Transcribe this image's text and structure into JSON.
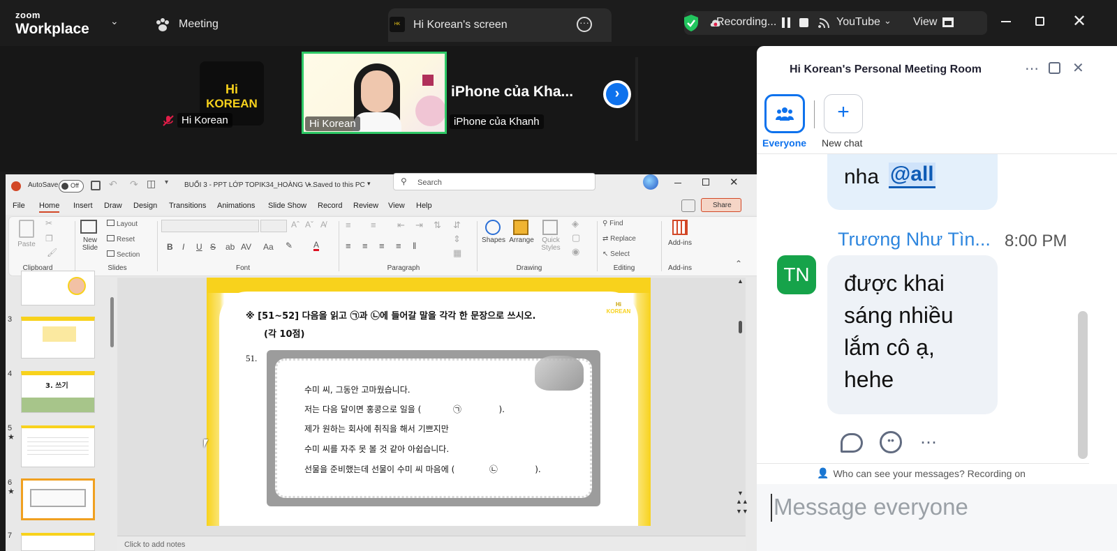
{
  "topbar": {
    "logo_small": "zoom",
    "logo_big": "Workplace",
    "meeting_label": "Meeting",
    "share_tab_label": "Hi Korean's screen",
    "recording_label": "Recording...",
    "youtube_label": "YouTube",
    "view_label": "View"
  },
  "videos": [
    {
      "name": "Hi Korean",
      "avatar_text_1": "Hi",
      "avatar_text_2": "KOREAN"
    },
    {
      "name": "Hi Korean"
    },
    {
      "name": "iPhone của Khanh",
      "title": "iPhone của Kha..."
    }
  ],
  "ppt": {
    "autosave": "AutoSave",
    "autosave_state": "Off",
    "file_name": "BUỔI 3 - PPT LỚP TOPIK34_HOÀNG V...",
    "saved": "• Saved to this PC",
    "search_placeholder": "Search",
    "menu": [
      "File",
      "Home",
      "Insert",
      "Draw",
      "Design",
      "Transitions",
      "Animations",
      "Slide Show",
      "Record",
      "Review",
      "View",
      "Help"
    ],
    "share": "Share",
    "ribbon": {
      "paste": "Paste",
      "clipboard": "Clipboard",
      "new_slide": "New Slide",
      "layout": "Layout",
      "reset": "Reset",
      "section": "Section",
      "slides": "Slides",
      "font": "Font",
      "paragraph": "Paragraph",
      "shapes": "Shapes",
      "arrange": "Arrange",
      "quick_styles": "Quick Styles",
      "drawing": "Drawing",
      "find": "Find",
      "replace": "Replace",
      "select": "Select",
      "editing": "Editing",
      "addins": "Add-ins",
      "addins_group": "Add-ins"
    },
    "thumbs": [
      {
        "num": "",
        "title": ""
      },
      {
        "num": "3",
        "title": ""
      },
      {
        "num": "4",
        "title": "3. 쓰기"
      },
      {
        "num": "5",
        "title": ""
      },
      {
        "num": "6",
        "title": ""
      },
      {
        "num": "7",
        "title": ""
      }
    ],
    "notes": "Click to add notes"
  },
  "slide": {
    "question": "※ [51~52] 다음을 읽고 ㉠과 ㉡에 들어갈 말을 각각 한 문장으로 쓰시오.",
    "points": "(각 10점)",
    "number": "51.",
    "logo_1": "Hi",
    "logo_2": "KOREAN",
    "lines": [
      "수미 씨, 그동안 고마웠습니다.",
      "저는 다음 달이면 홍콩으로 일을 (            ㉠              ).",
      "제가 원하는 회사에 취직을 해서 기쁘지만",
      "수미 씨를 자주 못 볼 것 같아 아쉽습니다.",
      "선물을 준비했는데 선물이 수미 씨 마음에 (             ㉡              )."
    ]
  },
  "chat": {
    "title": "Hi Korean's Personal Meeting Room",
    "everyone": "Everyone",
    "new_chat": "New chat",
    "msg1_text": "nha",
    "msg1_mention": "@all",
    "sender": "Trương Như Tìn...",
    "time": "8:00 PM",
    "avatar": "TN",
    "msg2_lines": [
      "được khai",
      "sáng nhiều",
      "lắm cô ạ,",
      "hehe"
    ],
    "privacy": "Who can see your messages? Recording on",
    "input_placeholder": "Message everyone"
  },
  "colors": {
    "zoom_blue": "#0e72ed",
    "recording_green": "#22c55e",
    "tab_green": "#2ec866",
    "slide_yellow": "#f8d21c",
    "avatar_green": "#16a34a",
    "ppt_orange": "#d24726"
  }
}
